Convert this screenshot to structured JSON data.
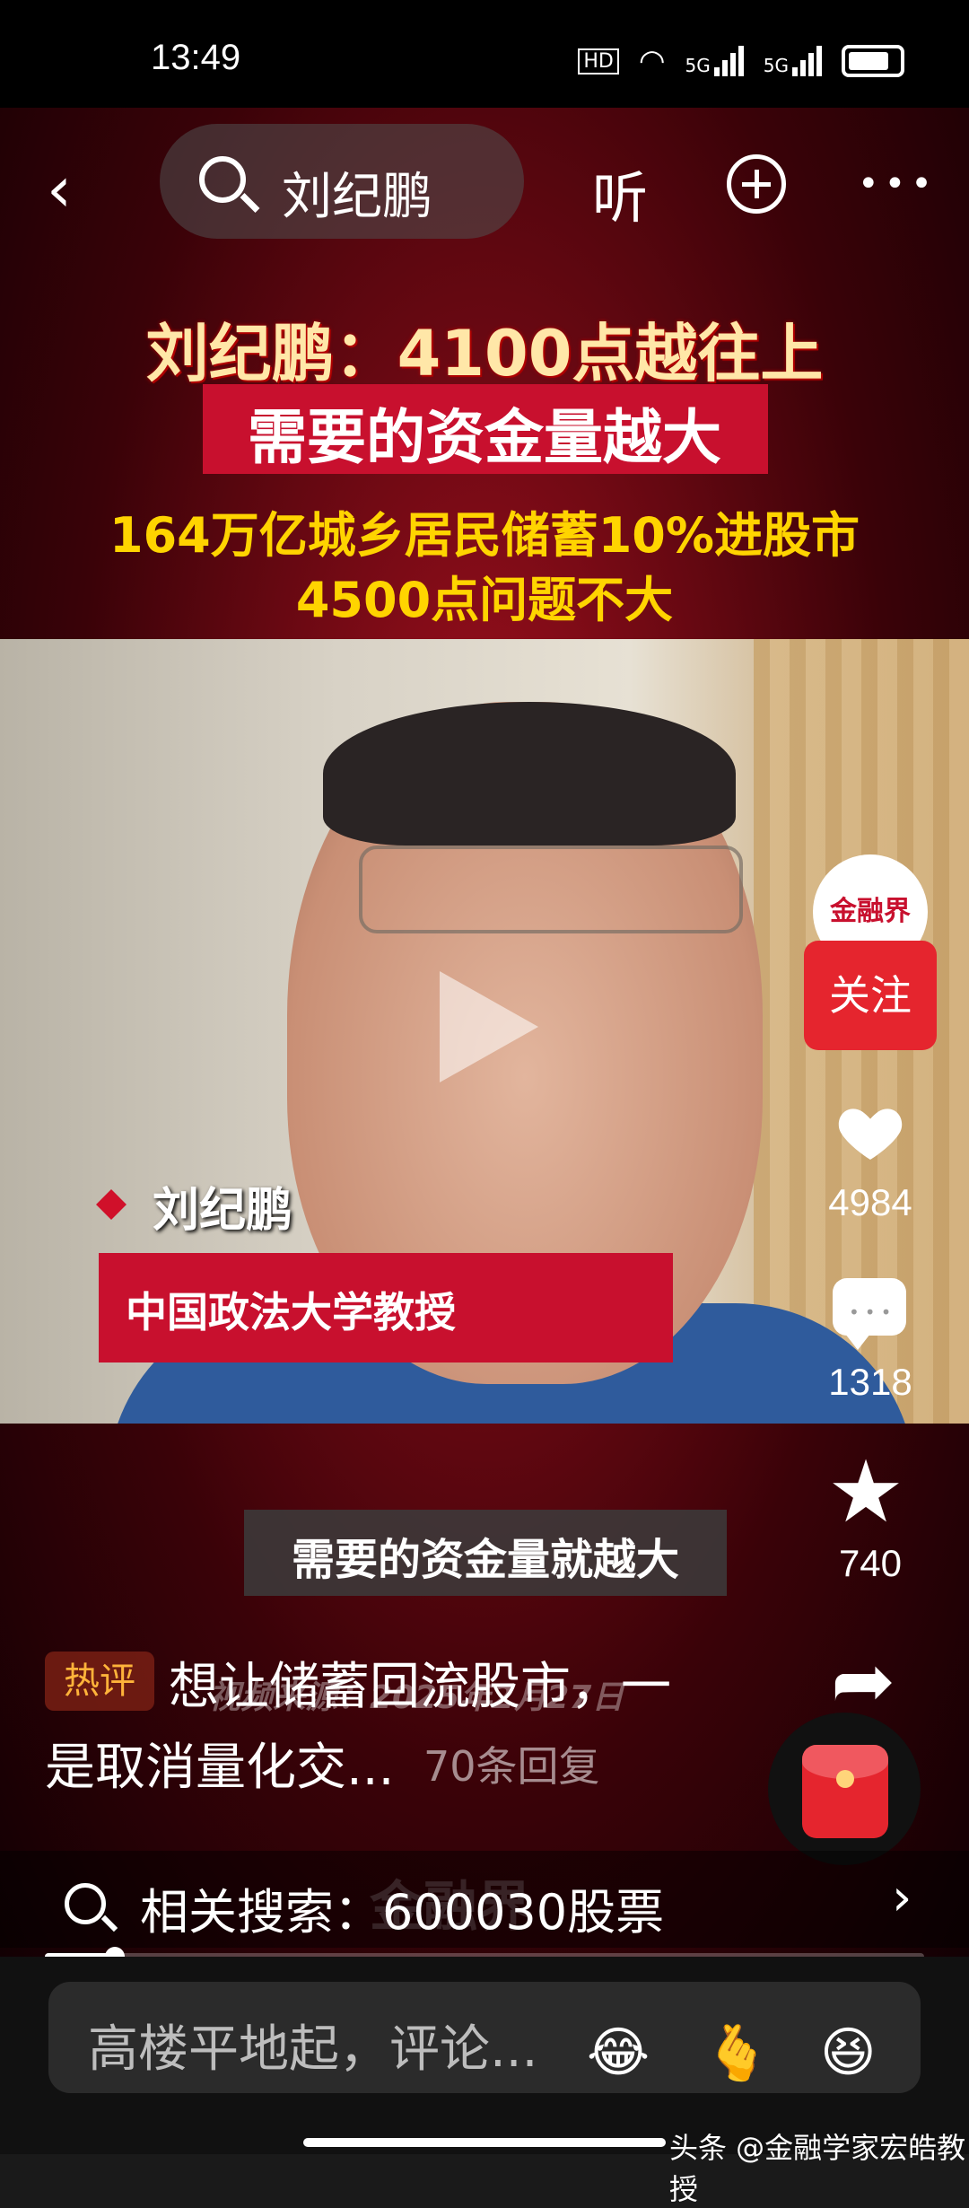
{
  "status": {
    "time": "13:49",
    "hd": "HD",
    "net1": "5G",
    "net2": "5G"
  },
  "nav": {
    "search_query": "刘纪鹏",
    "listen_label": "听"
  },
  "headline": {
    "line1": "刘纪鹏：4100点越往上",
    "line2": "需要的资金量越大",
    "line3": "164万亿城乡居民储蓄10%进股市",
    "line4": "4500点问题不大"
  },
  "video": {
    "speaker_name": "刘纪鹏",
    "speaker_title": "中国政法大学教授",
    "subtitle": "需要的资金量就越大",
    "watermark": "视频来源：2025年2月27日",
    "watermark_logo": "金融界"
  },
  "rail": {
    "avatar_text": "金融界",
    "follow_label": "关注",
    "likes": "4984",
    "comments": "1318",
    "favorites": "740",
    "share_label": "分享"
  },
  "hot_comment": {
    "badge": "热评",
    "line1": "想让储蓄回流股市，一",
    "line2": "是取消量化交...",
    "replies": "70条回复"
  },
  "related": {
    "label": "相关搜索：600030股票"
  },
  "progress": {
    "fraction": 0.08
  },
  "comment_input": {
    "placeholder": "高楼平地起，评论..."
  },
  "emojis": [
    "😂",
    "🫰",
    "😆"
  ],
  "credit": "头条 @金融学家宏皓教授",
  "colors": {
    "brand_red": "#c8102e",
    "follow_red": "#e5252e",
    "headline_yellow": "#ffd400"
  }
}
